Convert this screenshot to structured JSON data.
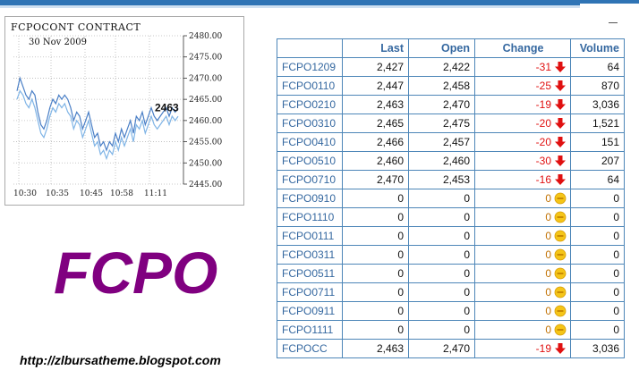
{
  "chart": {
    "title": "FCPOCONT CONTRACT",
    "date": "30 Nov 2009",
    "y_ticks": [
      "2480.00",
      "2475.00",
      "2470.00",
      "2465.00",
      "2460.00",
      "2455.00",
      "2450.00",
      "2445.00"
    ],
    "x_ticks": [
      "10:30",
      "10:35",
      "10:45",
      "10:58",
      "11:11"
    ],
    "last_value": "2463",
    "line_color": "#4a7fc6"
  },
  "chart_data": {
    "type": "line",
    "title": "FCPOCONT CONTRACT",
    "subtitle": "30 Nov 2009",
    "ylim": [
      2445,
      2480
    ],
    "grid": true,
    "y_tick_values": [
      2480,
      2475,
      2470,
      2465,
      2460,
      2455,
      2450,
      2445
    ],
    "x_ticks": [
      "10:30",
      "10:35",
      "10:45",
      "10:58",
      "11:11"
    ],
    "series": [
      {
        "values": [
          2467,
          2470,
          2468,
          2466,
          2465,
          2467,
          2466,
          2462,
          2459,
          2458,
          2460,
          2463,
          2465,
          2464,
          2466,
          2465,
          2466,
          2465,
          2463,
          2460,
          2462,
          2461,
          2458,
          2460,
          2462,
          2459,
          2456,
          2457,
          2454,
          2455,
          2453,
          2455,
          2454,
          2457,
          2455,
          2458,
          2456,
          2458,
          2460,
          2457,
          2461,
          2460,
          2462,
          2459,
          2461,
          2463,
          2461,
          2460,
          2461,
          2462,
          2463,
          2461,
          2463,
          2462,
          2463
        ]
      },
      {
        "values": [
          2465,
          2467,
          2466,
          2464,
          2463,
          2465,
          2463,
          2460,
          2457,
          2456,
          2458,
          2461,
          2463,
          2462,
          2464,
          2463,
          2464,
          2462,
          2461,
          2458,
          2460,
          2459,
          2456,
          2458,
          2460,
          2457,
          2454,
          2455,
          2452,
          2453,
          2451,
          2453,
          2452,
          2455,
          2453,
          2456,
          2454,
          2456,
          2458,
          2455,
          2459,
          2458,
          2460,
          2457,
          2459,
          2461,
          2459,
          2458,
          2459,
          2460,
          2461,
          2459,
          2461,
          2460,
          2461
        ]
      }
    ]
  },
  "brand": {
    "text": "FCPO",
    "color": "#800080"
  },
  "footer": {
    "url": "http://zlbursatheme.blogspot.com"
  },
  "table": {
    "headers": {
      "name": "",
      "last": "Last",
      "open": "Open",
      "change": "Change",
      "volume": "Volume"
    },
    "rows": [
      {
        "name": "FCPO1209",
        "last": "2,427",
        "open": "2,422",
        "change": "-31",
        "dir": "down",
        "volume": "64"
      },
      {
        "name": "FCPO0110",
        "last": "2,447",
        "open": "2,458",
        "change": "-25",
        "dir": "down",
        "volume": "870"
      },
      {
        "name": "FCPO0210",
        "last": "2,463",
        "open": "2,470",
        "change": "-19",
        "dir": "down",
        "volume": "3,036"
      },
      {
        "name": "FCPO0310",
        "last": "2,465",
        "open": "2,475",
        "change": "-20",
        "dir": "down",
        "volume": "1,521"
      },
      {
        "name": "FCPO0410",
        "last": "2,466",
        "open": "2,457",
        "change": "-20",
        "dir": "down",
        "volume": "151"
      },
      {
        "name": "FCPO0510",
        "last": "2,460",
        "open": "2,460",
        "change": "-30",
        "dir": "down",
        "volume": "207"
      },
      {
        "name": "FCPO0710",
        "last": "2,470",
        "open": "2,453",
        "change": "-16",
        "dir": "down",
        "volume": "64"
      },
      {
        "name": "FCPO0910",
        "last": "0",
        "open": "0",
        "change": "0",
        "dir": "flat",
        "volume": "0"
      },
      {
        "name": "FCPO1110",
        "last": "0",
        "open": "0",
        "change": "0",
        "dir": "flat",
        "volume": "0"
      },
      {
        "name": "FCPO0111",
        "last": "0",
        "open": "0",
        "change": "0",
        "dir": "flat",
        "volume": "0"
      },
      {
        "name": "FCPO0311",
        "last": "0",
        "open": "0",
        "change": "0",
        "dir": "flat",
        "volume": "0"
      },
      {
        "name": "FCPO0511",
        "last": "0",
        "open": "0",
        "change": "0",
        "dir": "flat",
        "volume": "0"
      },
      {
        "name": "FCPO0711",
        "last": "0",
        "open": "0",
        "change": "0",
        "dir": "flat",
        "volume": "0"
      },
      {
        "name": "FCPO0911",
        "last": "0",
        "open": "0",
        "change": "0",
        "dir": "flat",
        "volume": "0"
      },
      {
        "name": "FCPO1111",
        "last": "0",
        "open": "0",
        "change": "0",
        "dir": "flat",
        "volume": "0"
      },
      {
        "name": "FCPOCC",
        "last": "2,463",
        "open": "2,470",
        "change": "-19",
        "dir": "down",
        "volume": "3,036"
      }
    ],
    "colors": {
      "down": "#e01010",
      "flat": "#f5c518",
      "link": "#3568a0"
    }
  }
}
